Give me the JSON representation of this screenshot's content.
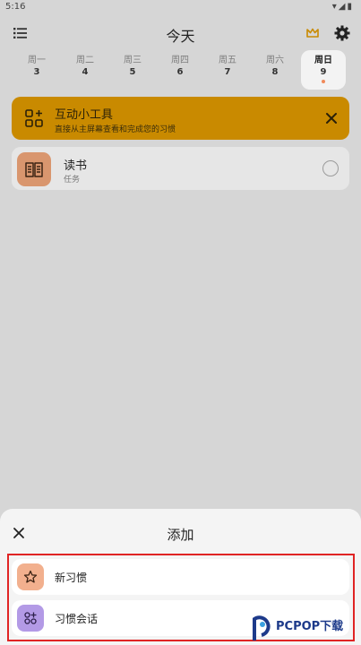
{
  "status_bar": {
    "time": "5:16",
    "icons": [
      "wifi-icon",
      "signal-icon",
      "battery-icon"
    ]
  },
  "header": {
    "title": "今天"
  },
  "week": [
    {
      "name": "周一",
      "num": "3",
      "selected": false
    },
    {
      "name": "周二",
      "num": "4",
      "selected": false
    },
    {
      "name": "周三",
      "num": "5",
      "selected": false
    },
    {
      "name": "周四",
      "num": "6",
      "selected": false
    },
    {
      "name": "周五",
      "num": "7",
      "selected": false
    },
    {
      "name": "周六",
      "num": "8",
      "selected": false
    },
    {
      "name": "周日",
      "num": "9",
      "selected": true
    }
  ],
  "widget_banner": {
    "title": "互动小工具",
    "subtitle": "直接从主屏幕查看和完成您的习惯",
    "color": "#c98a00"
  },
  "task": {
    "name": "读书",
    "type": "任务",
    "icon_color": "#d9966e"
  },
  "sheet": {
    "title": "添加",
    "options": [
      {
        "label": "新习惯",
        "icon": "star-icon",
        "color": "#f2b08e"
      },
      {
        "label": "习惯会话",
        "icon": "apps-icon",
        "color": "#b39ae6"
      }
    ]
  },
  "watermark": {
    "text": "PCPOP下载"
  }
}
